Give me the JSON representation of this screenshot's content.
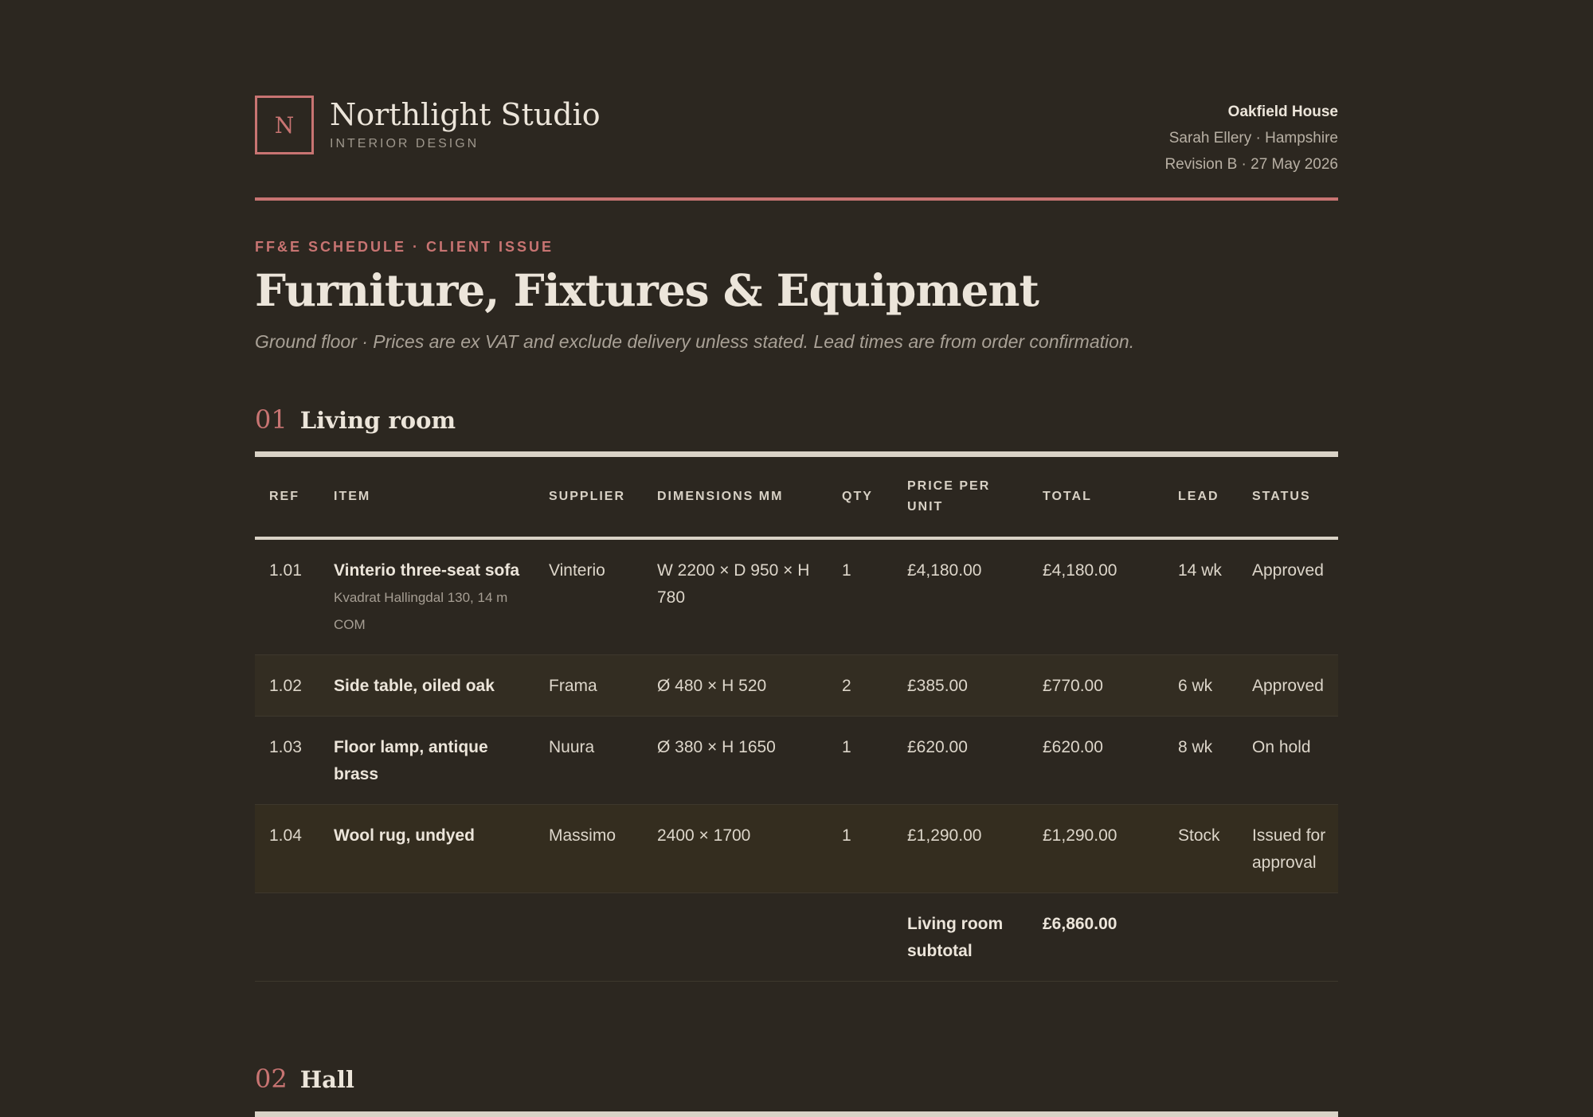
{
  "studio": {
    "logo_letter": "N",
    "name": "Northlight Studio",
    "tagline": "INTERIOR DESIGN"
  },
  "client": {
    "project": "Oakfield House",
    "contact": "Sarah Ellery · Hampshire",
    "revision": "Revision B · 27 May 2026"
  },
  "document": {
    "eyebrow": "FF&E SCHEDULE · CLIENT ISSUE",
    "title": "Furniture, Fixtures & Equipment",
    "subtitle": "Ground floor · Prices are ex VAT and exclude delivery unless stated. Lead times are from order confirmation."
  },
  "table": {
    "headers": {
      "ref": "REF",
      "item": "ITEM",
      "supplier": "SUPPLIER",
      "dimensions": "DIMENSIONS MM",
      "qty": "QTY",
      "price": "PRICE PER UNIT",
      "total": "TOTAL",
      "lead": "LEAD",
      "status": "STATUS"
    }
  },
  "sections": [
    {
      "number": "01",
      "name": "Living room",
      "rows": [
        {
          "ref": "1.01",
          "item": "Vinterio three-seat sofa",
          "note": "Kvadrat Hallingdal 130, 14 m COM",
          "supplier": "Vinterio",
          "dimensions": "W 2200 × D 950 × H 780",
          "qty": "1",
          "price": "£4,180.00",
          "total": "£4,180.00",
          "lead": "14 wk",
          "status": "Approved"
        },
        {
          "ref": "1.02",
          "item": "Side table, oiled oak",
          "note": "",
          "supplier": "Frama",
          "dimensions": "Ø 480 × H 520",
          "qty": "2",
          "price": "£385.00",
          "total": "£770.00",
          "lead": "6 wk",
          "status": "Approved"
        },
        {
          "ref": "1.03",
          "item": "Floor lamp, antique brass",
          "note": "",
          "supplier": "Nuura",
          "dimensions": "Ø 380 × H 1650",
          "qty": "1",
          "price": "£620.00",
          "total": "£620.00",
          "lead": "8 wk",
          "status": "On hold"
        },
        {
          "ref": "1.04",
          "item": "Wool rug, undyed",
          "note": "",
          "supplier": "Massimo",
          "dimensions": "2400 × 1700",
          "qty": "1",
          "price": "£1,290.00",
          "total": "£1,290.00",
          "lead": "Stock",
          "status": "Issued for approval"
        }
      ],
      "subtotal_label": "Living room subtotal",
      "subtotal_value": "£6,860.00"
    },
    {
      "number": "02",
      "name": "Hall"
    }
  ]
}
